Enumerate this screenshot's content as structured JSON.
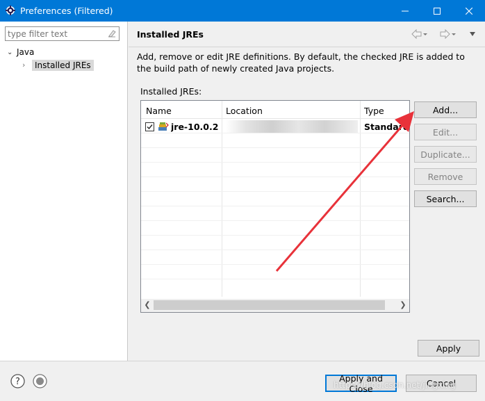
{
  "window": {
    "title": "Preferences (Filtered)"
  },
  "left_pane": {
    "filter_placeholder": "type filter text",
    "tree": {
      "root": "Java",
      "child": "Installed JREs"
    }
  },
  "page": {
    "title": "Installed JREs",
    "description": "Add, remove or edit JRE definitions. By default, the checked JRE is added to the build path of newly created Java projects.",
    "list_label": "Installed JREs:"
  },
  "table": {
    "columns": [
      "Name",
      "Location",
      "Type"
    ],
    "rows": [
      {
        "checked": true,
        "name": "jre-10.0.2 ...",
        "location": "",
        "type": "Standard V"
      }
    ]
  },
  "side_buttons": {
    "add": "Add...",
    "edit": "Edit...",
    "duplicate": "Duplicate...",
    "remove": "Remove",
    "search": "Search..."
  },
  "apply_button": "Apply",
  "footer": {
    "apply_close": "Apply and Close",
    "cancel": "Cancel"
  },
  "watermark": "https://blog.csdn.net/jingxing",
  "colors": {
    "titlebar": "#0078d7",
    "annotation_arrow": "#e8323a"
  },
  "icons": [
    "eclipse-gear-icon",
    "minimize-icon",
    "maximize-icon",
    "close-icon",
    "clear-filter-icon",
    "back-icon",
    "forward-icon",
    "view-menu-icon",
    "jre-library-icon",
    "help-icon",
    "tip-icon"
  ]
}
